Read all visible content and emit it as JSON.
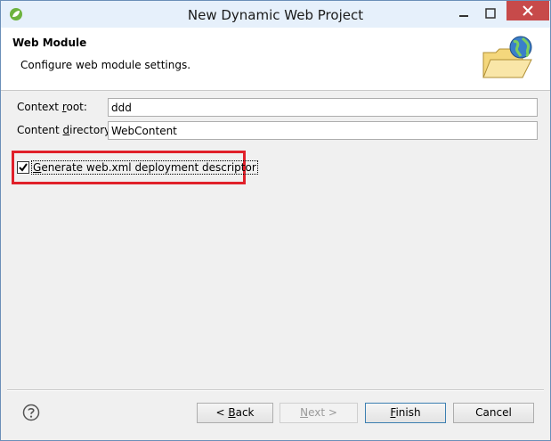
{
  "window": {
    "title": "New Dynamic Web Project"
  },
  "header": {
    "title": "Web Module",
    "description": "Configure web module settings."
  },
  "form": {
    "context_root": {
      "label_prefix": "Context ",
      "label_mnemonic": "r",
      "label_suffix": "oot:",
      "value": "ddd"
    },
    "content_directory": {
      "label_prefix": "Content ",
      "label_mnemonic": "d",
      "label_suffix": "irectory:",
      "value": "WebContent"
    },
    "generate_descriptor": {
      "label_mnemonic": "G",
      "label_suffix": "enerate web.xml deployment descriptor",
      "checked": true
    }
  },
  "buttons": {
    "back": {
      "label_prefix": "< ",
      "label_mnemonic": "B",
      "label_suffix": "ack"
    },
    "next": {
      "label_prefix": "",
      "label_mnemonic": "N",
      "label_suffix": "ext >"
    },
    "finish": {
      "label_prefix": "",
      "label_mnemonic": "F",
      "label_suffix": "inish"
    },
    "cancel": {
      "label": "Cancel"
    }
  },
  "icons": {
    "app": "spring-leaf-icon",
    "header": "web-module-folder-globe-icon",
    "help": "help-icon"
  },
  "colors": {
    "highlight": "#e0202a",
    "close_button": "#c74a4a",
    "titlebar": "#e6f0fb"
  }
}
